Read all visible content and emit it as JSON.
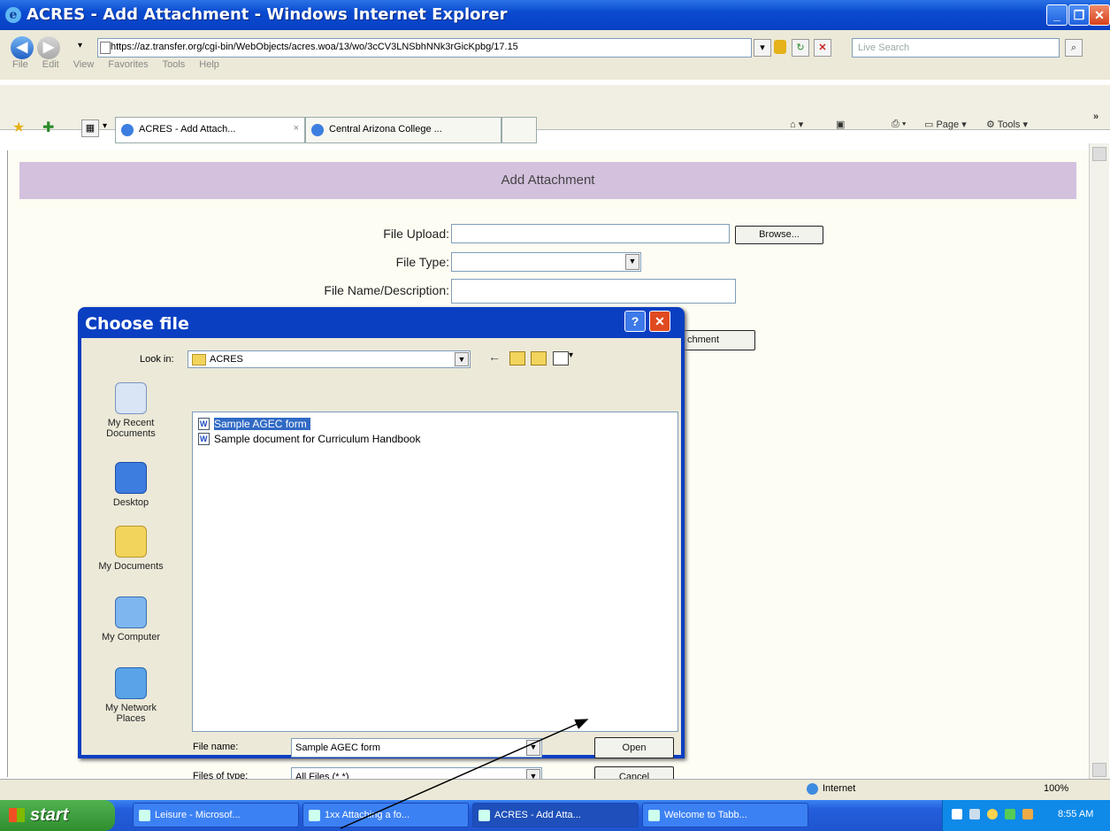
{
  "window": {
    "title": "ACRES - Add Attachment - Windows Internet Explorer",
    "controls": [
      "_",
      "❐",
      "✕"
    ]
  },
  "browser": {
    "url": "https://az.transfer.org/cgi-bin/WebObjects/acres.woa/13/wo/3cCV3LNSbhNNk3rGicKpbg/17.15",
    "search_placeholder": "Live Search",
    "menu": [
      "File",
      "Edit",
      "View",
      "Favorites",
      "Tools",
      "Help"
    ],
    "tabs": [
      {
        "label": "ACRES - Add Attach..."
      },
      {
        "label": "Central Arizona College ..."
      }
    ],
    "toolbar": {
      "page_label": "Page",
      "tools_label": "Tools"
    },
    "status": {
      "zone": "Internet",
      "zoom": "100%"
    }
  },
  "page": {
    "header": "Add Attachment",
    "file_upload_label": "File Upload:",
    "browse_label": "Browse...",
    "file_type_label": "File Type:",
    "file_name_label": "File Name/Description:",
    "attach_button_partial": "chment"
  },
  "dialog": {
    "title": "Choose file",
    "look_in_label": "Look in:",
    "look_in_value": "ACRES",
    "files": [
      {
        "name": "Sample AGEC form",
        "selected": true
      },
      {
        "name": "Sample document for Curriculum Handbook",
        "selected": false
      }
    ],
    "places": [
      {
        "label": "My Recent Documents",
        "icon": "recent-documents-icon"
      },
      {
        "label": "Desktop",
        "icon": "desktop-icon"
      },
      {
        "label": "My Documents",
        "icon": "my-documents-icon"
      },
      {
        "label": "My Computer",
        "icon": "my-computer-icon"
      },
      {
        "label": "My Network Places",
        "icon": "network-places-icon"
      }
    ],
    "file_name_label": "File name:",
    "file_name_value": "Sample AGEC form",
    "file_type_label": "Files of type:",
    "file_type_value": "All Files (*.*)",
    "open_label": "Open",
    "cancel_label": "Cancel"
  },
  "taskbar": {
    "start_label": "start",
    "items": [
      {
        "label": "Leisure - Microsof..."
      },
      {
        "label": "1xx Attaching a fo..."
      },
      {
        "label": "ACRES - Add Atta..."
      },
      {
        "label": "Welcome to Tabb..."
      }
    ],
    "clock": "8:55 AM"
  }
}
